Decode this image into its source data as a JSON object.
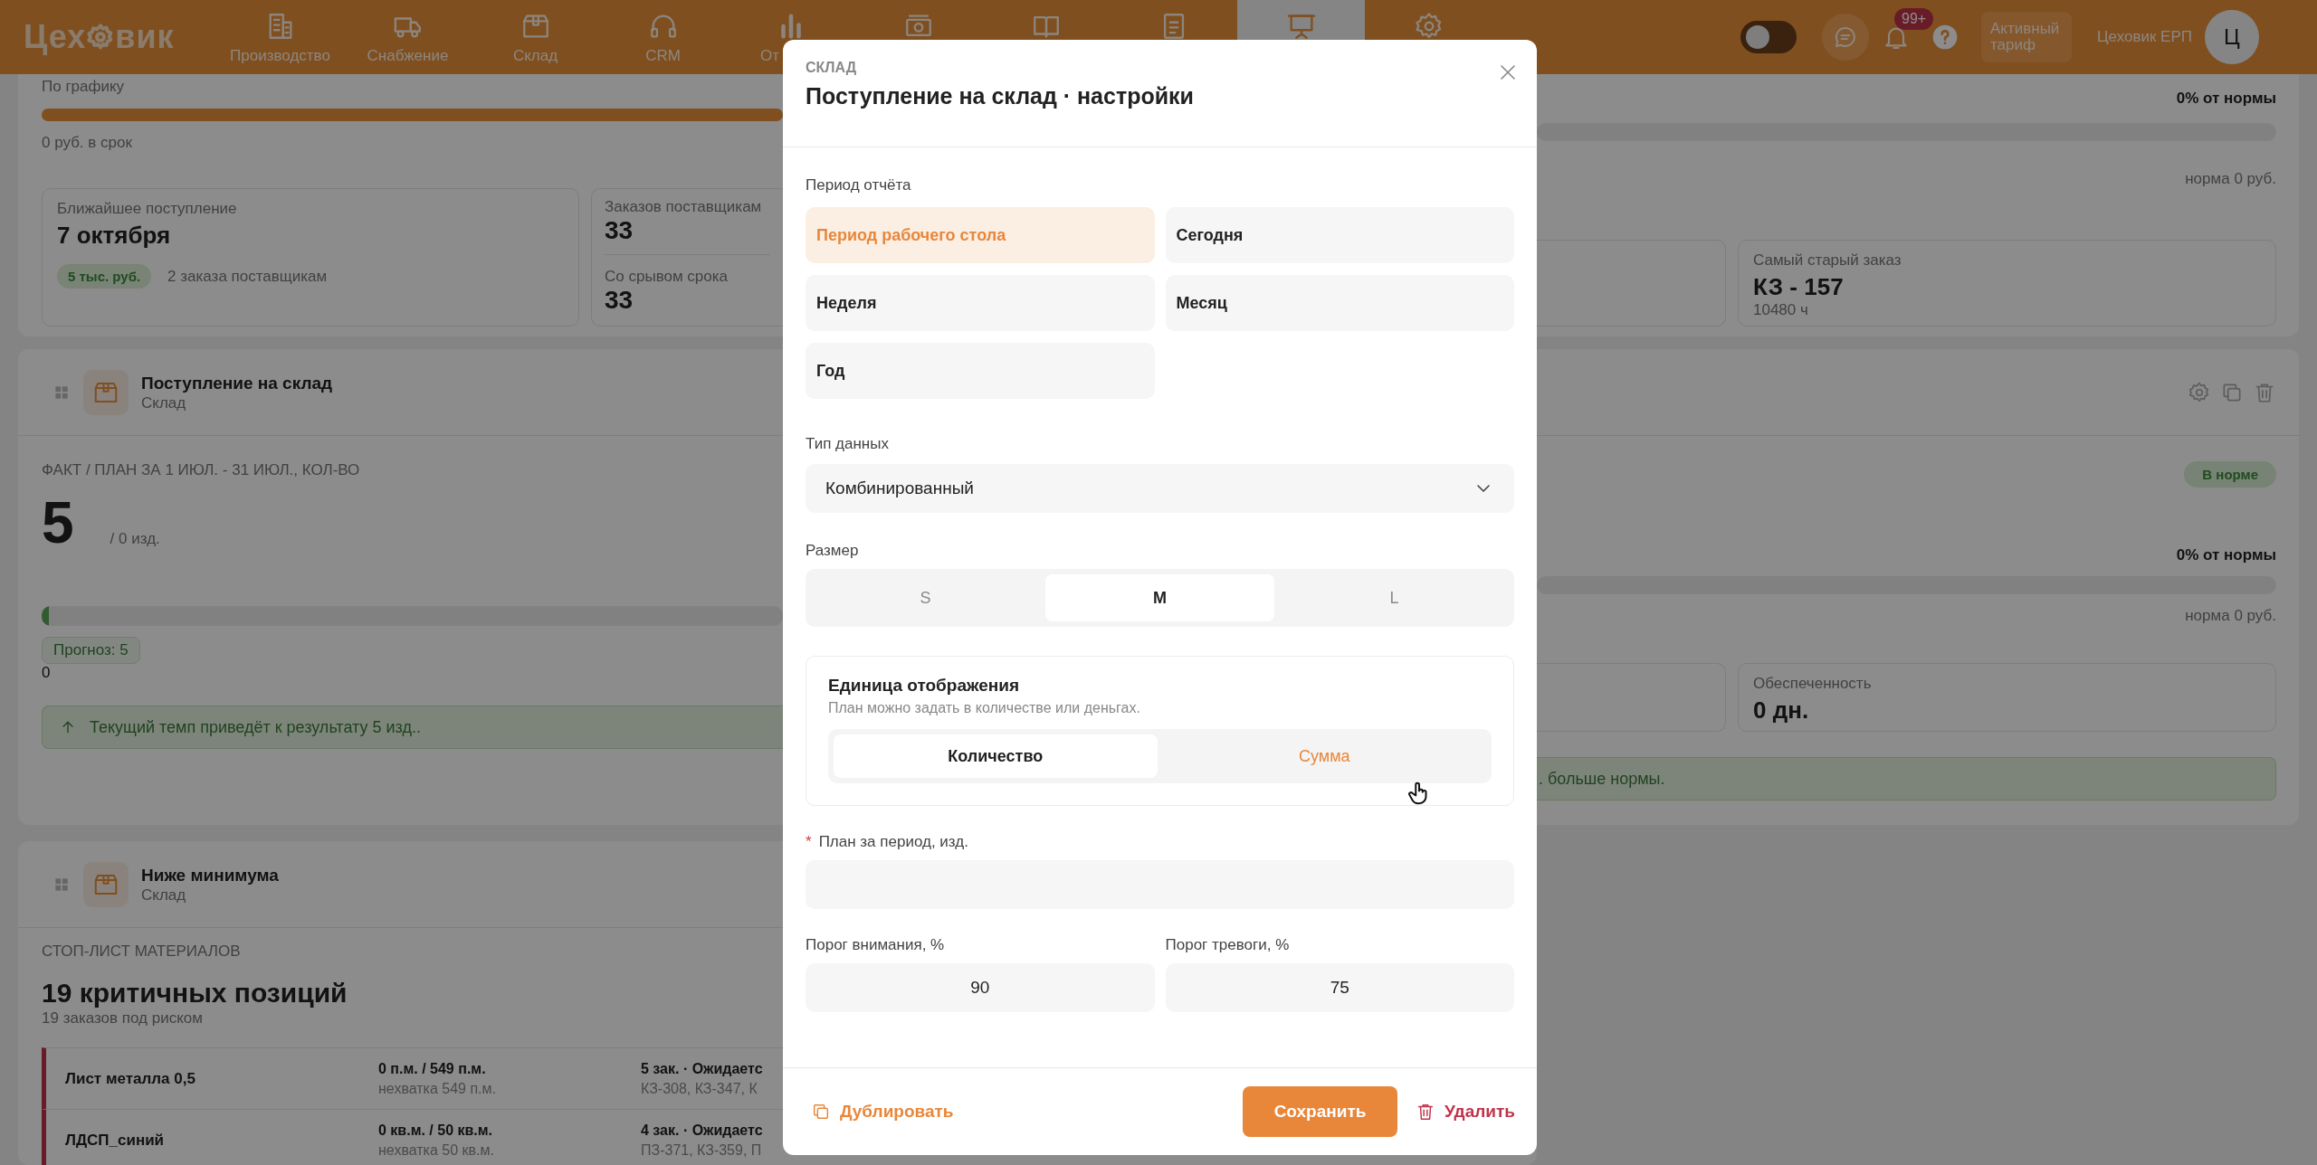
{
  "header": {
    "logo": {
      "left": "Цех",
      "right": "вик"
    },
    "nav": [
      {
        "kind": "building",
        "label": "Производство",
        "selected": false
      },
      {
        "kind": "truck",
        "label": "Снабжение",
        "selected": false
      },
      {
        "kind": "box",
        "label": "Склад",
        "selected": false
      },
      {
        "kind": "headset",
        "label": "CRM",
        "selected": false
      },
      {
        "kind": "chart",
        "label": "От",
        "selected": false
      },
      {
        "kind": "banknote",
        "selected": false
      },
      {
        "kind": "book",
        "selected": false
      },
      {
        "kind": "document",
        "selected": false
      },
      {
        "kind": "easel",
        "selected": true
      },
      {
        "kind": "gear",
        "selected": false
      }
    ],
    "theme_toggle": {
      "on": false
    },
    "notifications_badge": "99+",
    "tariff": "Активный тариф",
    "company": "Цеховик ЕРП",
    "avatar": "Ц"
  },
  "schedule_widget": {
    "left": {
      "label": "По графику",
      "level": 1,
      "caption": "0 руб. в срок",
      "arrival_card": {
        "title": "Ближайшее поступление",
        "value": "7 октября",
        "badge": "5 тыс. руб.",
        "note": "2 заказа поставщикам"
      },
      "orders_card": [
        {
          "title": "Заказов поставщикам",
          "value": "33"
        },
        {
          "title": "Со срывом срока",
          "value": "33"
        }
      ]
    },
    "right": {
      "percent": "0% от нормы",
      "level": 0,
      "norm": "норма 0 руб.",
      "card": {
        "title": "Самый старый заказ",
        "value": "КЗ - 157",
        "note": "10480 ч"
      }
    }
  },
  "inbound_widget": {
    "title": "Поступление на склад",
    "subtitle": "Склад",
    "metric_label": "ФАКТ / ПЛАН ЗА 1 ИЮЛ. - 31 ИЮЛ., КОЛ-ВО",
    "value": "5",
    "plan": "/ 0 изд.",
    "level": 0.01,
    "forecast": "Прогноз: 5",
    "scale_min": "0",
    "alert": "Текущий темп приведёт к результату 5 изд..",
    "right": {
      "status": "В норме",
      "percent": "0% от нормы",
      "level": 0,
      "norm": "норма 0 руб.",
      "card": {
        "title": "Обеспеченность",
        "value": "0 дн."
      },
      "alert": ". больше нормы."
    }
  },
  "minimum_widget": {
    "title": "Ниже минимума",
    "subtitle": "Склад",
    "section": "СТОП-ЛИСТ МАТЕРИАЛОВ",
    "headline": "19 критичных позиций",
    "subline": "19 заказов под риском",
    "rows": [
      {
        "name": "Лист металла 0,5",
        "qty": "0 п.м. / 549 п.м.",
        "shortage": "нехватка 549 п.м.",
        "orders": "5 зак. · Ожидаетс",
        "order_ids": "КЗ-308, КЗ-347, К"
      },
      {
        "name": "ЛДСП_синий",
        "qty": "0 кв.м. / 50 кв.м.",
        "shortage": "нехватка 50 кв.м.",
        "orders": "4 зак. · Ожидаетс",
        "order_ids": "ПЗ-371, КЗ-359, П"
      }
    ]
  },
  "modal": {
    "eyebrow": "СКЛАД",
    "title": "Поступление на склад · настройки",
    "period": {
      "label": "Период отчёта",
      "options": [
        {
          "label": "Период рабочего стола",
          "selected": true
        },
        {
          "label": "Сегодня",
          "selected": false
        },
        {
          "label": "Неделя",
          "selected": false
        },
        {
          "label": "Месяц",
          "selected": false
        },
        {
          "label": "Год",
          "selected": false
        }
      ]
    },
    "data_type": {
      "label": "Тип данных",
      "value": "Комбинированный"
    },
    "size": {
      "label": "Размер",
      "options": [
        {
          "label": "S",
          "selected": false
        },
        {
          "label": "M",
          "selected": true
        },
        {
          "label": "L",
          "selected": false
        }
      ]
    },
    "unit": {
      "title": "Единица отображения",
      "hint": "План можно задать в количестве или деньгах.",
      "options": [
        {
          "label": "Количество",
          "selected": true,
          "hovered": false
        },
        {
          "label": "Сумма",
          "selected": false,
          "hovered": true
        }
      ]
    },
    "plan": {
      "required_mark": "*",
      "label": "План за период, изд."
    },
    "thresholds": [
      {
        "label": "Порог внимания, %",
        "value": "90"
      },
      {
        "label": "Порог тревоги, %",
        "value": "75"
      }
    ],
    "footer": {
      "duplicate": "Дублировать",
      "save": "Сохранить",
      "delete": "Удалить"
    }
  }
}
